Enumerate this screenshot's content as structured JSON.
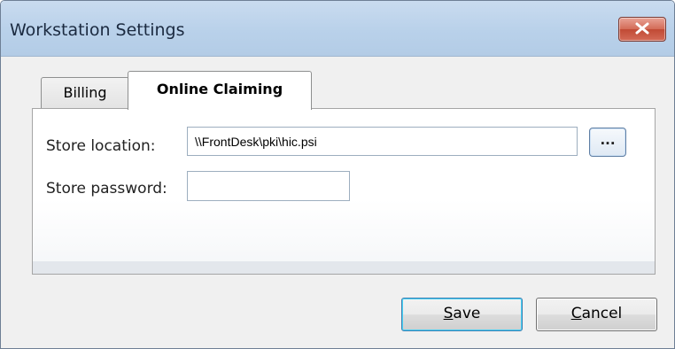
{
  "window": {
    "title": "Workstation Settings"
  },
  "tabs": [
    {
      "label": "Billing",
      "selected": false
    },
    {
      "label": "Online Claiming",
      "selected": true
    }
  ],
  "form": {
    "store_location_label": "Store location:",
    "store_location_value": "\\\\FrontDesk\\pki\\hic.psi",
    "browse_label": "...",
    "store_password_label": "Store password:",
    "store_password_value": ""
  },
  "buttons": {
    "save_mnemonic": "S",
    "save_rest": "ave",
    "cancel_mnemonic": "C",
    "cancel_rest": "ancel"
  },
  "colors": {
    "titlebar": "#b9d1ea",
    "close_button": "#c85a45",
    "default_button_border": "#3c7fb1"
  },
  "icons": {
    "close": "close-x-icon"
  }
}
